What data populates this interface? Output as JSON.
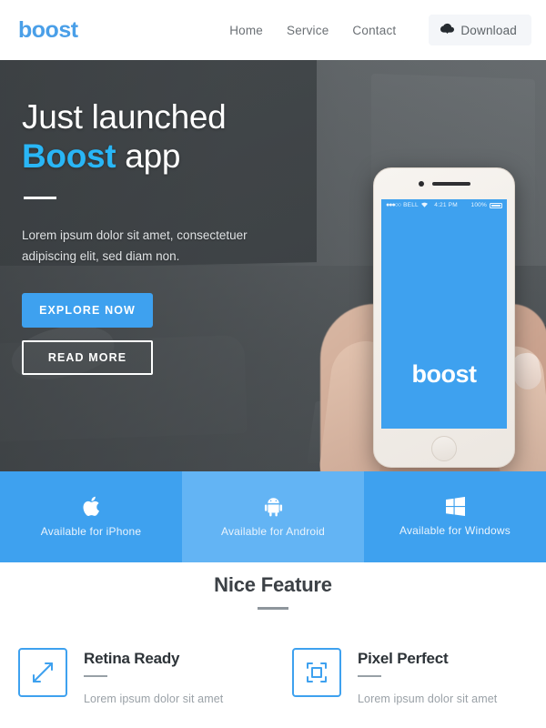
{
  "header": {
    "logo": "boost",
    "nav": [
      {
        "label": "Home"
      },
      {
        "label": "Service"
      },
      {
        "label": "Contact"
      }
    ],
    "download_button": {
      "label": "Download",
      "icon": "cloud-download-icon"
    }
  },
  "hero": {
    "title_line1": "Just launched",
    "title_accent": "Boost",
    "title_rest": " app",
    "subtitle": "Lorem ipsum dolor sit amet, consectetuer adipiscing elit, sed diam non.",
    "primary_button": "EXPLORE NOW",
    "secondary_button": "READ MORE",
    "phone": {
      "status_signal": "●●●○○",
      "status_carrier": "BELL",
      "status_time": "4:21 PM",
      "status_battery": "100%",
      "app_name": "boost"
    }
  },
  "platforms": [
    {
      "label": "Available for iPhone",
      "icon": "apple-icon",
      "bg": "#3ea1ef"
    },
    {
      "label": "Available for Android",
      "icon": "android-icon",
      "bg": "#63b4f4"
    },
    {
      "label": "Available for Windows",
      "icon": "windows-icon",
      "bg": "#3ea1ef"
    }
  ],
  "features_section": {
    "title": "Nice Feature",
    "items": [
      {
        "title": "Retina Ready",
        "text": "Lorem ipsum dolor sit amet",
        "icon": "expand-arrows-icon"
      },
      {
        "title": "Pixel Perfect",
        "text": "Lorem ipsum dolor sit amet",
        "icon": "crop-frame-icon"
      }
    ]
  },
  "colors": {
    "brand_blue": "#3ea1ef",
    "logo_blue": "#4a9fe8",
    "accent_cyan": "#29b6f6",
    "hero_dark": "#4b5053",
    "android_blue": "#63b4f4",
    "text_muted": "#9aa1a7"
  }
}
